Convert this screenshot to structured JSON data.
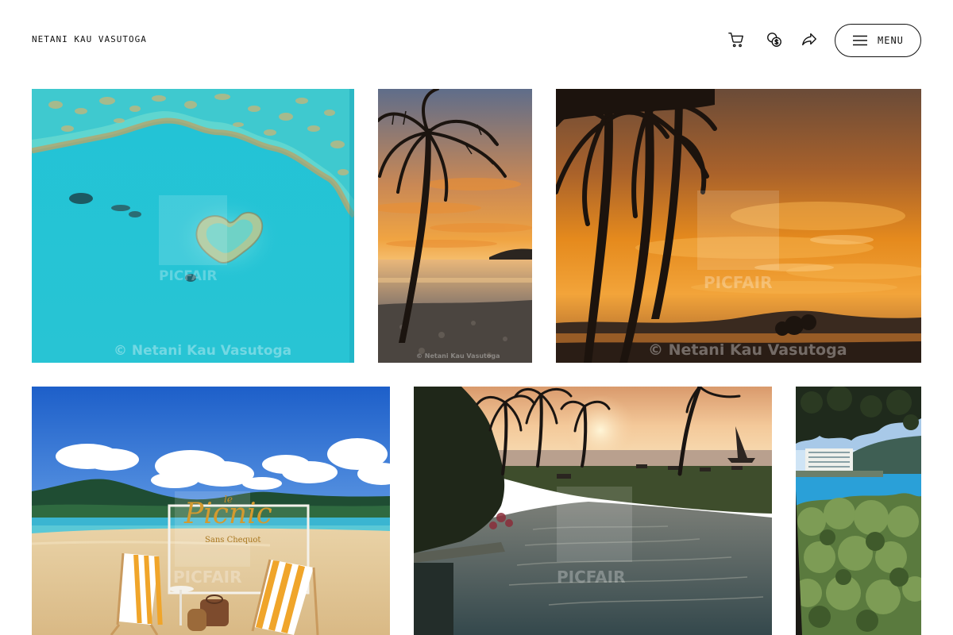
{
  "header": {
    "brand": "NETANI KAU VASUTOGA",
    "icons": [
      "cart-icon",
      "currency-icon",
      "share-icon"
    ],
    "menu_label": "MENU"
  },
  "gallery": {
    "watermark": "© Netani Kau Vasutoga",
    "brand_mark": "PICFAIR",
    "photos": [
      {
        "subject": "heart-reef"
      },
      {
        "subject": "palm-sunset-beach"
      },
      {
        "subject": "palm-sunset-hills"
      },
      {
        "subject": "beach-picnic"
      },
      {
        "subject": "infinity-pool-sunset"
      },
      {
        "subject": "marina-trees"
      }
    ],
    "picnic_sign": {
      "title": "Picnic",
      "prefix": "le",
      "subtitle": "Sans Chequot"
    }
  },
  "colors": {
    "text": "#111111",
    "background": "#ffffff"
  }
}
